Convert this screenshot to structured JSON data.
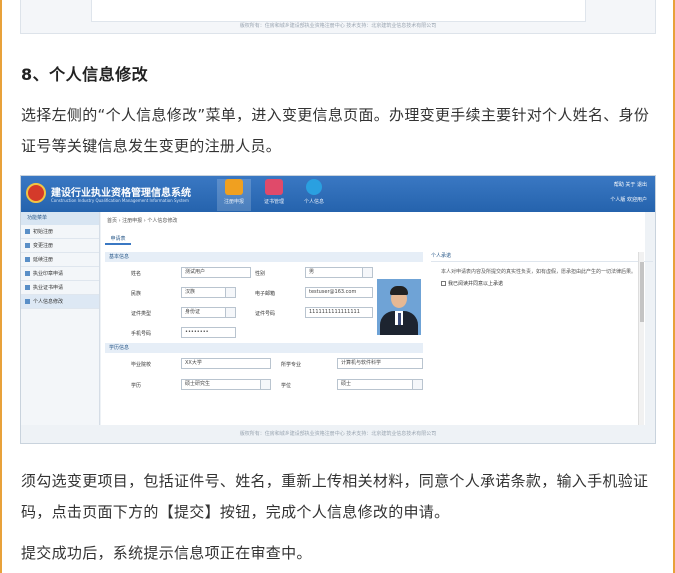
{
  "top_screenshot": {
    "footer_text": "版权所有：住房和城乡建设部执业资格注册中心   技术支持：北京建筑业信息技术有限公司"
  },
  "section_heading": "8、个人信息修改",
  "paragraph_1": "选择左侧的“个人信息修改”菜单，进入变更信息页面。办理变更手续主要针对个人姓名、身份证号等关键信息发生变更的注册人员。",
  "paragraph_2": "须勾选变更项目，包括证件号、姓名，重新上传相关材料，同意个人承诺条款，输入手机验证码，点击页面下方的【提交】按钮，完成个人信息修改的申请。",
  "paragraph_3": "提交成功后，系统提示信息项正在审查中。",
  "app": {
    "system_title": "建设行业执业资格管理信息系统",
    "system_subtitle": "Construction Industry Qualification Management Information System",
    "nav": [
      {
        "label": "注册申报",
        "icon": "document-icon",
        "color": "#f0a020"
      },
      {
        "label": "证书管理",
        "icon": "monitor-icon",
        "color": "#e04a6a"
      },
      {
        "label": "个人信息",
        "icon": "info-icon",
        "color": "#2aa0e0"
      }
    ],
    "header_links": "帮助   关于   退出",
    "header_user": "个人版  欢迎用户",
    "sidebar_title": "功能菜单",
    "sidebar_items": [
      "初始注册",
      "变更注册",
      "延续注册",
      "执业印章申请",
      "执业证书申请",
      "个人信息修改"
    ],
    "breadcrumb": "首页 › 注册申报 › 个人信息修改",
    "tab_label": "申请表",
    "section_basic": "基本信息",
    "section_edu": "学历信息",
    "fields": {
      "name_label": "姓名",
      "name_value": "测试用户",
      "gender_label": "性别",
      "gender_value": "男",
      "nation_label": "民族",
      "nation_value": "汉族",
      "email_label": "电子邮箱",
      "email_value": "testuser@163.com",
      "idtype_label": "证件类型",
      "idtype_value": "身份证",
      "idno_label": "证件号码",
      "idno_value": "1111111111111111",
      "phone_label": "手机号码",
      "phone_value": "••••••••",
      "school_label": "毕业院校",
      "school_value": "XX大学",
      "major_label": "所学专业",
      "major_value": "计算机与软件科学",
      "degree_label": "学历",
      "degree_value": "硕士研究生",
      "xuewei_label": "学位",
      "xuewei_value": "硕士"
    },
    "commitment_title": "个人承诺",
    "commitment_text": "本人对申请表内容及所提交的真实性负责，如有虚假，愿承担由此产生的一切法律后果。",
    "commitment_checkbox": "我已阅读并同意以上承诺",
    "footer": "版权所有：住房和城乡建设部执业资格注册中心   技术支持：北京建筑业信息技术有限公司"
  }
}
